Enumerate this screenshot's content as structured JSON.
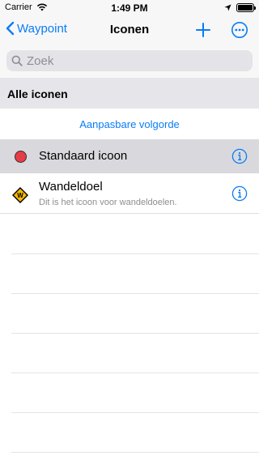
{
  "status_bar": {
    "carrier": "Carrier",
    "time": "1:49 PM",
    "battery_level": 1.0
  },
  "nav": {
    "back_label": "Waypoint",
    "title": "Iconen",
    "add_icon": "plus-icon",
    "more_icon": "ellipsis-circle-icon"
  },
  "search": {
    "placeholder": "Zoek",
    "value": ""
  },
  "section": {
    "title": "Alle iconen"
  },
  "reorder": {
    "label": "Aanpasbare volgorde"
  },
  "items": [
    {
      "title": "Standaard icoon",
      "subtitle": "",
      "icon": "red-circle-icon",
      "color": "#e83c44",
      "selected": true
    },
    {
      "title": "Wandeldoel",
      "subtitle": "Dit is het icoon voor wandeldoelen.",
      "icon": "hiking-sign-icon",
      "color": "#f5b800",
      "selected": false
    }
  ],
  "colors": {
    "accent": "#0a7cf6",
    "selected_row": "#d9d9dd",
    "section_bg": "#e6e6ea"
  }
}
